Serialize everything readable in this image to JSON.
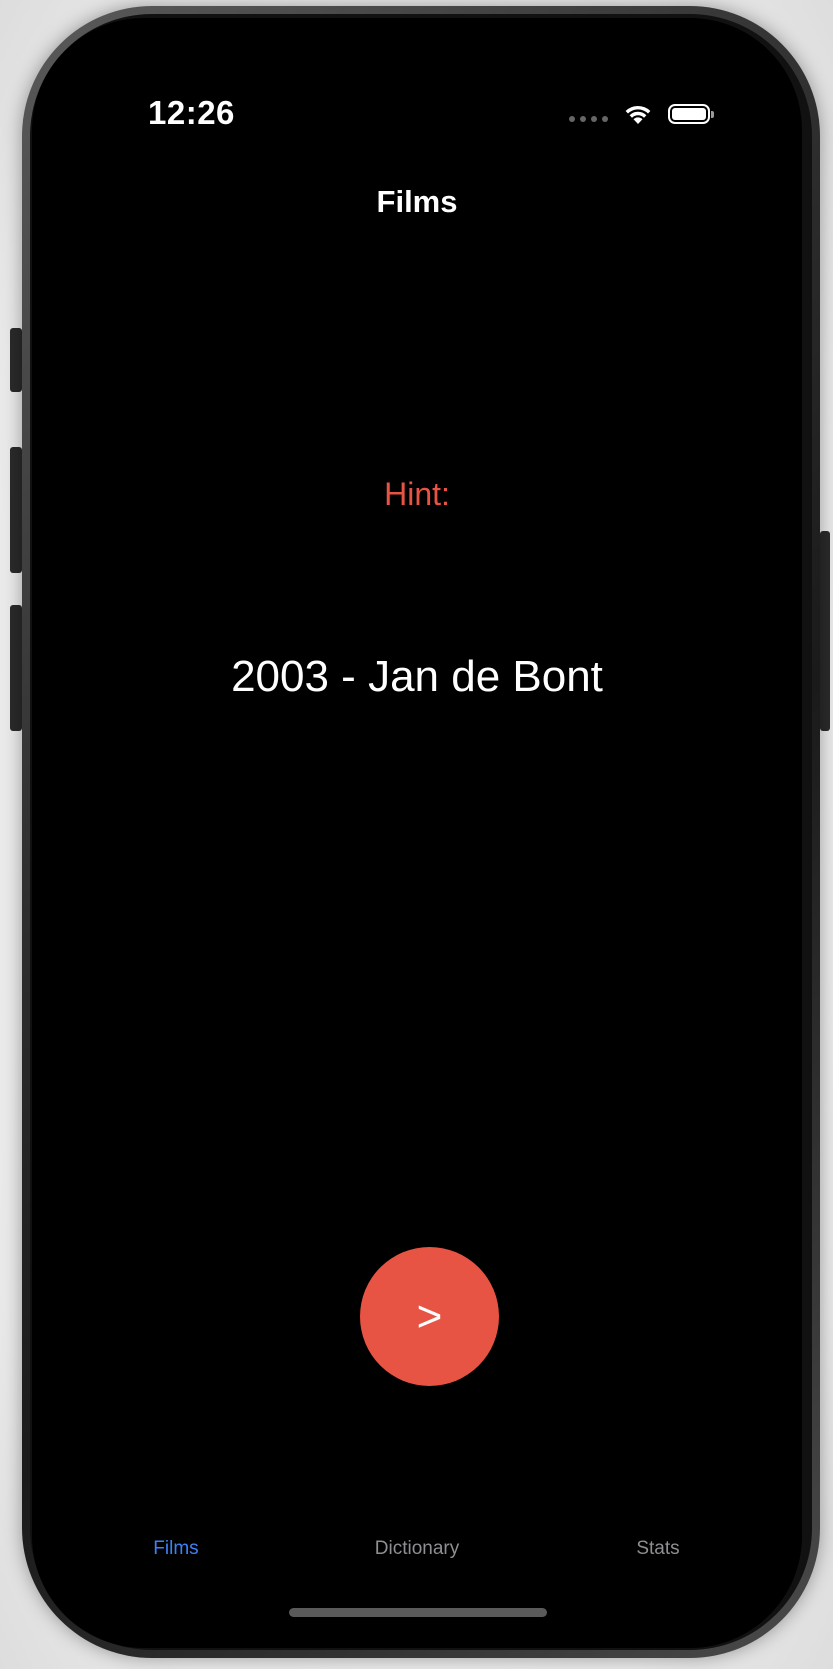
{
  "status_bar": {
    "time": "12:26"
  },
  "navigation": {
    "title": "Films"
  },
  "content": {
    "hint_label": "Hint:",
    "hint_text": "2003 - Jan de Bont",
    "next_button_label": ">"
  },
  "tab_bar": {
    "items": [
      {
        "label": "Films",
        "selected": true
      },
      {
        "label": "Dictionary",
        "selected": false
      },
      {
        "label": "Stats",
        "selected": false
      }
    ]
  },
  "colors": {
    "accent": "#E85444",
    "tab_selected": "#3A82F7",
    "tab_unselected": "#8E8E93",
    "background": "#000000"
  },
  "icons": {
    "cellular": "cellular-signal-icon",
    "wifi": "wifi-icon",
    "battery": "battery-icon"
  }
}
